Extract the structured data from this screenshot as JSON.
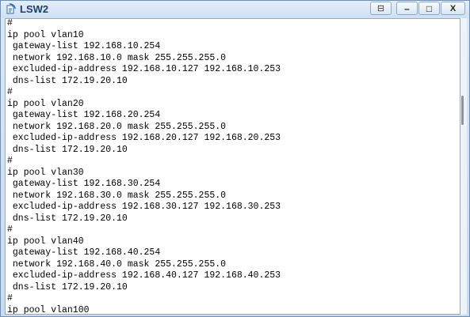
{
  "window": {
    "title": "LSW2",
    "controls": {
      "extra": "⊟",
      "minimize": "–",
      "maximize": "□",
      "close": "X"
    }
  },
  "terminal": {
    "lines": [
      "#",
      "ip pool vlan10",
      " gateway-list 192.168.10.254",
      " network 192.168.10.0 mask 255.255.255.0",
      " excluded-ip-address 192.168.10.127 192.168.10.253",
      " dns-list 172.19.20.10",
      "#",
      "ip pool vlan20",
      " gateway-list 192.168.20.254",
      " network 192.168.20.0 mask 255.255.255.0",
      " excluded-ip-address 192.168.20.127 192.168.20.253",
      " dns-list 172.19.20.10",
      "#",
      "ip pool vlan30",
      " gateway-list 192.168.30.254",
      " network 192.168.30.0 mask 255.255.255.0",
      " excluded-ip-address 192.168.30.127 192.168.30.253",
      " dns-list 172.19.20.10",
      "#",
      "ip pool vlan40",
      " gateway-list 192.168.40.254",
      " network 192.168.40.0 mask 255.255.255.0",
      " excluded-ip-address 192.168.40.127 192.168.40.253",
      " dns-list 172.19.20.10",
      "#",
      "ip pool vlan100"
    ]
  },
  "colors": {
    "title_text": "#1e3f66",
    "terminal_bg": "#ffffff",
    "frame": "#cfe0f2"
  },
  "icons": {
    "app": "switch-app-icon"
  }
}
